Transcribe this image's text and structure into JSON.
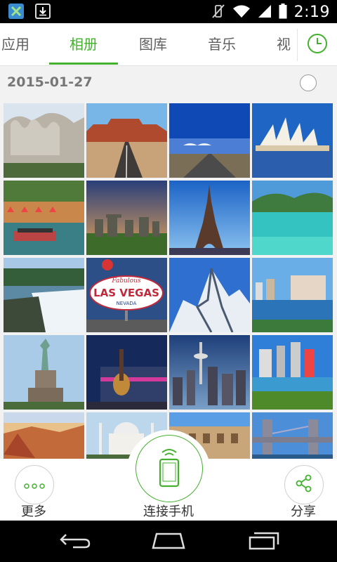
{
  "status_bar": {
    "time": "2:19"
  },
  "tabs": [
    {
      "label": "应用",
      "active": false
    },
    {
      "label": "相册",
      "active": true
    },
    {
      "label": "图库",
      "active": false
    },
    {
      "label": "音乐",
      "active": false
    },
    {
      "label": "视",
      "active": false
    }
  ],
  "album": {
    "date": "2015-01-27",
    "photos": [
      {
        "name": "mount-rushmore-photo"
      },
      {
        "name": "monument-valley-road-photo"
      },
      {
        "name": "desert-highway-photo"
      },
      {
        "name": "sydney-opera-house-photo"
      },
      {
        "name": "san-antonio-riverwalk-photo"
      },
      {
        "name": "stonehenge-photo"
      },
      {
        "name": "eiffel-tower-photo"
      },
      {
        "name": "tropical-lagoon-photo"
      },
      {
        "name": "niagara-falls-photo"
      },
      {
        "name": "las-vegas-sign-photo",
        "sign_line1": "Fabulous",
        "sign_line2": "LAS VEGAS",
        "sign_line3": "NEVADA"
      },
      {
        "name": "snowy-mountain-photo"
      },
      {
        "name": "harbor-city-skyline-photo"
      },
      {
        "name": "statue-of-liberty-photo"
      },
      {
        "name": "guitar-building-photo"
      },
      {
        "name": "seattle-space-needle-photo"
      },
      {
        "name": "city-park-skyline-photo"
      },
      {
        "name": "grand-canyon-photo"
      },
      {
        "name": "taj-mahal-photo"
      },
      {
        "name": "colosseum-photo"
      },
      {
        "name": "tower-bridge-photo"
      }
    ]
  },
  "bottom_bar": {
    "more_label": "更多",
    "connect_label": "连接手机",
    "share_label": "分享"
  },
  "colors": {
    "accent": "#43b12e",
    "status_bar": "#000000",
    "nav_bar": "#000000"
  }
}
